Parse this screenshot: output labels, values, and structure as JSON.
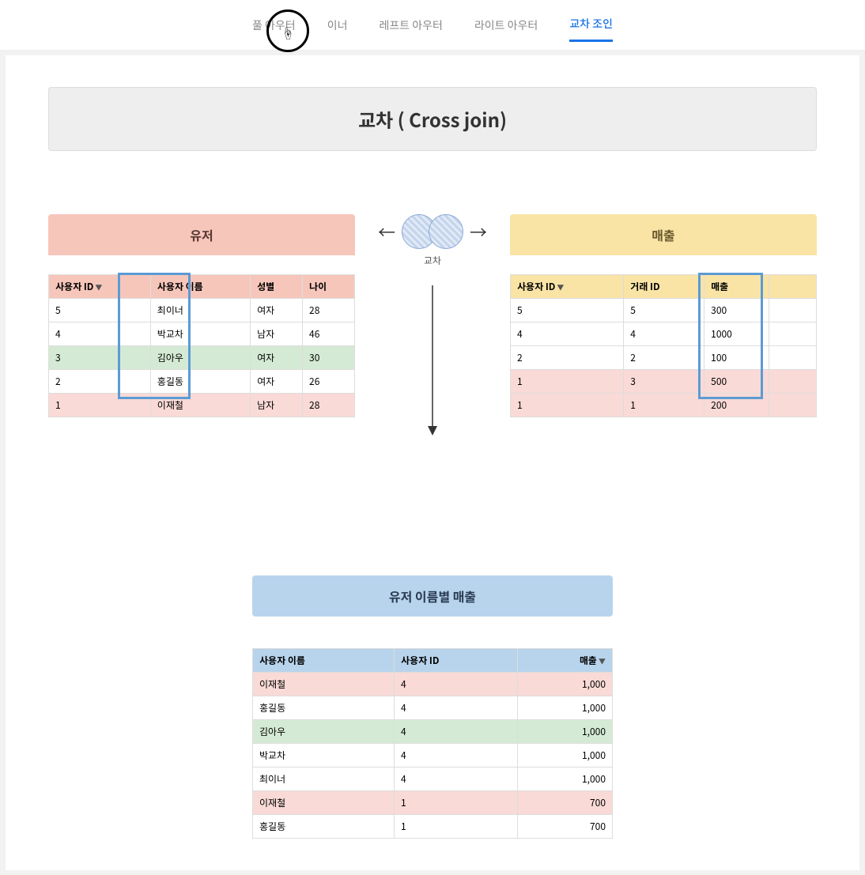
{
  "tabs": {
    "items": [
      "풀 아우터",
      "이너",
      "레프트 아우터",
      "라이트 아우터",
      "교차 조인"
    ],
    "active_index": 4
  },
  "title": "교차 ( Cross join)",
  "left": {
    "title": "유저",
    "headers": [
      "사용자 ID",
      "사용자 이름",
      "성별",
      "나이"
    ],
    "rows": [
      {
        "cells": [
          "5",
          "최이너",
          "여자",
          "28"
        ],
        "cls": ""
      },
      {
        "cells": [
          "4",
          "박교차",
          "남자",
          "46"
        ],
        "cls": ""
      },
      {
        "cells": [
          "3",
          "김아우",
          "여자",
          "30"
        ],
        "cls": "row-green"
      },
      {
        "cells": [
          "2",
          "홍길동",
          "여자",
          "26"
        ],
        "cls": ""
      },
      {
        "cells": [
          "1",
          "이재철",
          "남자",
          "28"
        ],
        "cls": "row-pink"
      }
    ]
  },
  "right": {
    "title": "매출",
    "headers": [
      "사용자 ID",
      "거래 ID",
      "매출"
    ],
    "rows": [
      {
        "cells": [
          "5",
          "5",
          "300"
        ],
        "cls": ""
      },
      {
        "cells": [
          "4",
          "4",
          "1000"
        ],
        "cls": ""
      },
      {
        "cells": [
          "2",
          "2",
          "100"
        ],
        "cls": ""
      },
      {
        "cells": [
          "1",
          "3",
          "500"
        ],
        "cls": "row-pink"
      },
      {
        "cells": [
          "1",
          "1",
          "200"
        ],
        "cls": "row-pink"
      }
    ]
  },
  "venn_label": "교차",
  "result": {
    "title": "유저 이름별 매출",
    "headers": [
      "사용자 이름",
      "사용자 ID",
      "매출"
    ],
    "rows": [
      {
        "cells": [
          "이재철",
          "4",
          "1,000"
        ],
        "cls": "row-pink"
      },
      {
        "cells": [
          "홍길동",
          "4",
          "1,000"
        ],
        "cls": ""
      },
      {
        "cells": [
          "김아우",
          "4",
          "1,000"
        ],
        "cls": "row-green"
      },
      {
        "cells": [
          "박교차",
          "4",
          "1,000"
        ],
        "cls": ""
      },
      {
        "cells": [
          "최이너",
          "4",
          "1,000"
        ],
        "cls": ""
      },
      {
        "cells": [
          "이재철",
          "1",
          "700"
        ],
        "cls": "row-pink"
      },
      {
        "cells": [
          "홍길동",
          "1",
          "700"
        ],
        "cls": ""
      }
    ]
  }
}
